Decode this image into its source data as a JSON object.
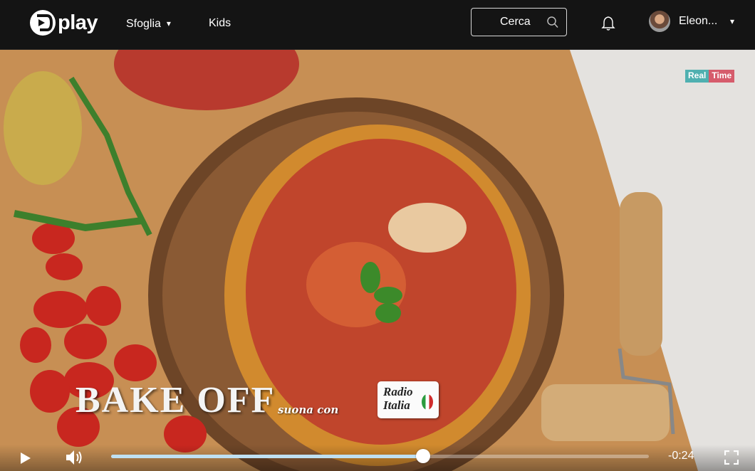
{
  "header": {
    "logo_text": "play",
    "nav": [
      {
        "label": "Sfoglia",
        "caret": "▾"
      },
      {
        "label": "Kids"
      }
    ],
    "search": {
      "label": "Cerca",
      "icon": "search-icon"
    },
    "notifications_icon": "bell-icon",
    "user": {
      "name": "Eleon...",
      "caret": "▾"
    }
  },
  "video": {
    "channel_logo": [
      "Real",
      "Time"
    ],
    "title_overlay": "BAKE OFF",
    "subtitle_overlay": "suona con",
    "sponsor": "Radio Italia",
    "accent_color": "#bfe0f2"
  },
  "player": {
    "progress": 0.58,
    "time_remaining": "-0:24",
    "icons": [
      "play-icon",
      "volume-icon",
      "fullscreen-icon"
    ]
  }
}
